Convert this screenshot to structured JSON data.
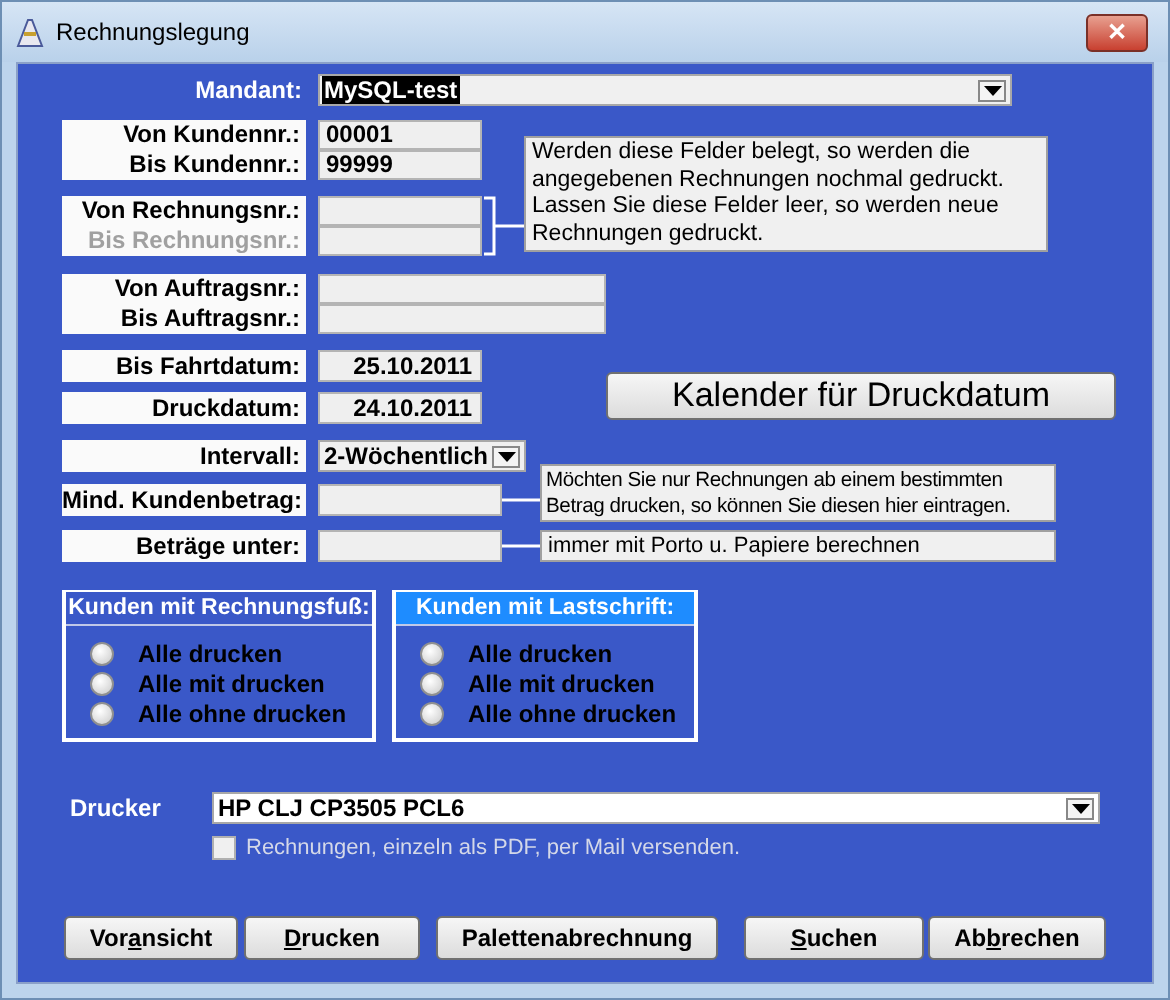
{
  "window": {
    "title": "Rechnungslegung",
    "close": "✕"
  },
  "mandant": {
    "label": "Mandant:",
    "value": "MySQL-test",
    "value_highlighted": true
  },
  "range_groups": [
    {
      "fields": [
        {
          "label": "Von Kundennr.:",
          "value": "00001",
          "disabled": false
        },
        {
          "label": "Bis Kundennr.:",
          "value": "99999",
          "disabled": false
        }
      ]
    },
    {
      "fields": [
        {
          "label": "Von Rechnungsnr.:",
          "disabled": false
        },
        {
          "label": "Bis Rechnungsnr.:",
          "disabled": true
        }
      ]
    },
    {
      "fields": [
        {
          "label": "Von Auftragsnr.:",
          "disabled": false
        },
        {
          "label": "Bis Auftragsnr.:",
          "disabled": false
        }
      ]
    }
  ],
  "range_note": "Werden diese Felder belegt, so werden die angegebenen Rechnungen nochmal gedruckt. Lassen Sie diese Felder leer, so werden neue Rechnungen gedruckt.",
  "dates": [
    {
      "label": "Bis Fahrtdatum:",
      "value": "25.10.2011"
    },
    {
      "label": "Druckdatum:",
      "value": "24.10.2011"
    }
  ],
  "calendar_button": "Kalender für Druckdatum",
  "interval": {
    "label": "Intervall:",
    "value": "2-Wöchentlich"
  },
  "amount_fields": [
    {
      "label": "Mind. Kundenbetrag:",
      "note": "Möchten Sie nur Rechnungen ab einem bestimmten Betrag drucken, so können Sie diesen hier eintragen."
    },
    {
      "label": "Beträge unter:",
      "note": "immer mit Porto u. Papiere berechnen"
    }
  ],
  "radio_groups": [
    {
      "title": "Kunden mit Rechnungsfuß:",
      "focused": false,
      "options": [
        {
          "label": "Alle drucken",
          "selected": false
        },
        {
          "label": "Alle mit drucken",
          "selected": false
        },
        {
          "label": "Alle ohne drucken",
          "selected": false
        }
      ]
    },
    {
      "title": "Kunden mit Lastschrift:",
      "focused": true,
      "options": [
        {
          "label": "Alle drucken",
          "selected": false
        },
        {
          "label": "Alle mit drucken",
          "selected": false
        },
        {
          "label": "Alle ohne drucken",
          "selected": false
        }
      ]
    }
  ],
  "printer": {
    "label": "Drucker",
    "value": "HP CLJ CP3505 PCL6"
  },
  "pdf_checkbox": {
    "label": "Rechnungen, einzeln als PDF, per Mail versenden.",
    "checked": false,
    "disabled": true
  },
  "buttons": [
    {
      "before": "Vor",
      "key": "a",
      "after": "nsicht"
    },
    {
      "key": "D",
      "after": "rucken"
    },
    {
      "before": "Palettenabrechnung"
    },
    {
      "key": "S",
      "after": "uchen"
    },
    {
      "before": "Ab",
      "key": "b",
      "after": "rechen"
    }
  ]
}
